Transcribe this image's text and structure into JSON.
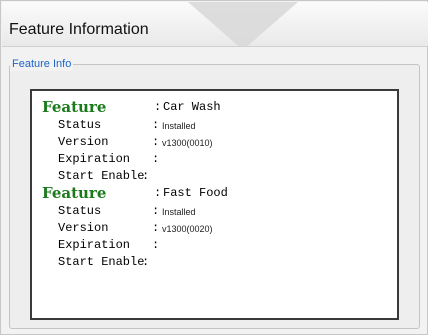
{
  "window": {
    "title": "Feature Information"
  },
  "group": {
    "legend": "Feature Info"
  },
  "features": [
    {
      "label": "Feature",
      "name": "Car Wash",
      "rows": {
        "status_label": "Status",
        "status_value": "Installed",
        "version_label": "Version",
        "version_value": "v1300(0010)",
        "expiration_label": "Expiration",
        "expiration_value": "",
        "start_label": "Start Enable",
        "start_value": ""
      }
    },
    {
      "label": "Feature",
      "name": "Fast Food",
      "rows": {
        "status_label": "Status",
        "status_value": "Installed",
        "version_label": "Version",
        "version_value": "v1300(0020)",
        "expiration_label": "Expiration",
        "expiration_value": "",
        "start_label": "Start Enable",
        "start_value": ""
      }
    }
  ],
  "colors": {
    "feature_label": "#1a7a1a",
    "legend": "#1e64c8",
    "panel_border": "#3a3a3a"
  }
}
